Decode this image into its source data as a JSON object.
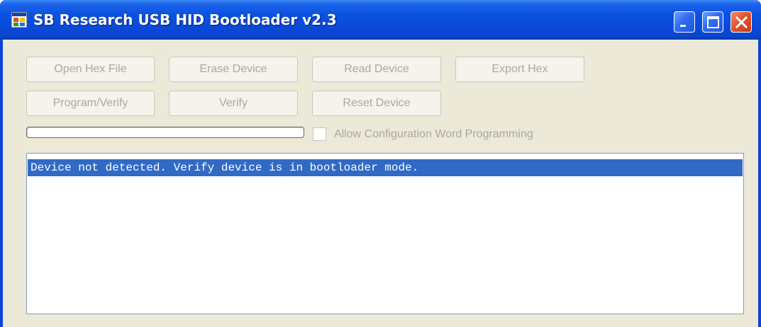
{
  "window": {
    "title": "SB Research USB HID Bootloader v2.3"
  },
  "toolbar": {
    "open_hex_label": "Open Hex File",
    "erase_label": "Erase Device",
    "read_label": "Read Device",
    "export_label": "Export Hex",
    "program_verify_label": "Program/Verify",
    "verify_label": "Verify",
    "reset_label": "Reset Device"
  },
  "progress": {
    "value_percent": 0
  },
  "options": {
    "allow_config_label": "Allow Configuration Word Programming",
    "allow_config_checked": false
  },
  "output": {
    "lines": [
      "Device not detected. Verify device is in bootloader mode."
    ],
    "selected_line_color": "#316ac5"
  },
  "colors": {
    "titlebar": "#0a4ad8",
    "client_background": "#ece9d8",
    "disabled_text": "#aca899",
    "close_button": "#e2542a"
  },
  "icons": {
    "app": "application-icon",
    "minimize": "minimize-icon",
    "maximize": "maximize-icon",
    "close": "close-icon"
  }
}
